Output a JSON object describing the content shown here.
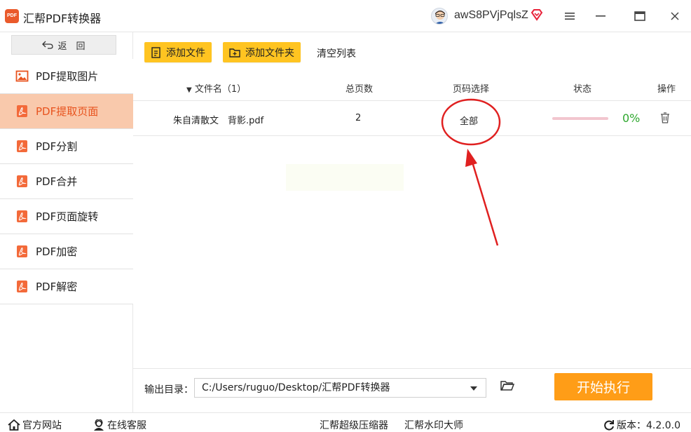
{
  "titlebar": {
    "logo_text": "PDF",
    "app_title": "汇帮PDF转换器",
    "username": "awS8PVjPqlsZ"
  },
  "sidebar": {
    "back_label": "返　回",
    "items": [
      {
        "label": "PDF提取图片",
        "icon": "image-icon",
        "active": false
      },
      {
        "label": "PDF提取页面",
        "icon": "pdf-icon",
        "active": true
      },
      {
        "label": "PDF分割",
        "icon": "pdf-icon",
        "active": false
      },
      {
        "label": "PDF合并",
        "icon": "pdf-icon",
        "active": false
      },
      {
        "label": "PDF页面旋转",
        "icon": "pdf-icon",
        "active": false
      },
      {
        "label": "PDF加密",
        "icon": "pdf-icon",
        "active": false
      },
      {
        "label": "PDF解密",
        "icon": "pdf-icon",
        "active": false
      }
    ]
  },
  "toolbar": {
    "add_file": "添加文件",
    "add_folder": "添加文件夹",
    "clear_list": "清空列表"
  },
  "table": {
    "headers": {
      "filename": "文件名（1）",
      "pages": "总页数",
      "page_select": "页码选择",
      "status": "状态",
      "action": "操作"
    },
    "rows": [
      {
        "filename": "朱自清散文　背影.pdf",
        "pages": "2",
        "page_select": "全部",
        "progress": 0,
        "percent": "0%"
      }
    ]
  },
  "output": {
    "label": "输出目录：",
    "path": "C:/Users/ruguo/Desktop/汇帮PDF转换器",
    "start_button": "开始执行"
  },
  "footer": {
    "website": "官方网站",
    "support": "在线客服",
    "compressor": "汇帮超级压缩器",
    "watermark": "汇帮水印大师",
    "version": "版本：4.2.0.0"
  },
  "colors": {
    "accent_orange": "#ff9d17",
    "toolbar_yellow": "#ffc421",
    "active_nav_bg": "#f9c9ac",
    "active_nav_text": "#e8531e",
    "progress_green": "#2ea82e",
    "annotation_red": "#e02020"
  }
}
